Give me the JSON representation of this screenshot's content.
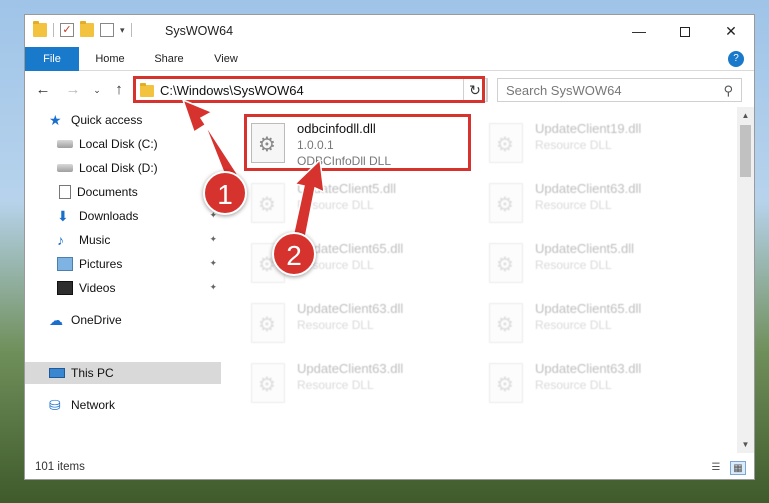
{
  "window": {
    "title": "SysWOW64",
    "minimize": "—",
    "maximize": "",
    "close": "✕"
  },
  "ribbon": {
    "tabs": [
      "File",
      "Home",
      "Share",
      "View"
    ],
    "expand": "?"
  },
  "nav": {
    "back": "←",
    "forward": "→",
    "recent": "⌄",
    "up": "↑",
    "address": "C:\\Windows\\SysWOW64",
    "address_drop": "⌄",
    "refresh": "↻",
    "search_placeholder": "Search SysWOW64",
    "search_icon": "search-icon"
  },
  "sidebar": {
    "items": [
      {
        "label": "Quick access",
        "icon": "star-icon",
        "pin": false
      },
      {
        "label": "Local Disk (C:)",
        "icon": "disk-icon",
        "pin": false
      },
      {
        "label": "Local Disk (D:)",
        "icon": "disk-icon",
        "pin": false
      },
      {
        "label": "Documents",
        "icon": "document-icon",
        "pin": true
      },
      {
        "label": "Downloads",
        "icon": "download-icon",
        "pin": true
      },
      {
        "label": "Music",
        "icon": "music-icon",
        "pin": true
      },
      {
        "label": "Pictures",
        "icon": "picture-icon",
        "pin": true
      },
      {
        "label": "Videos",
        "icon": "video-icon",
        "pin": true
      },
      {
        "label": "OneDrive",
        "icon": "cloud-icon",
        "pin": false
      },
      {
        "label": "This PC",
        "icon": "pc-icon",
        "pin": false,
        "selected": true
      },
      {
        "label": "Network",
        "icon": "network-icon",
        "pin": false
      }
    ],
    "pin_glyph": "📌"
  },
  "files": {
    "highlighted": {
      "name": "odbcinfodll.dll",
      "version": "1.0.0.1",
      "description": "ODBCInfoDll DLL"
    },
    "background": [
      {
        "name": "UpdateClient19.dll",
        "desc": "Resource DLL"
      },
      {
        "name": "UpdateClient5.dll",
        "desc": "Resource DLL"
      },
      {
        "name": "UpdateClient63.dll",
        "desc": "Resource DLL"
      },
      {
        "name": "UpdateClient65.dll",
        "desc": "Resource DLL"
      },
      {
        "name": "UpdateClient5.dll",
        "desc": "Resource DLL"
      },
      {
        "name": "UpdateClient63.dll",
        "desc": "Resource DLL"
      },
      {
        "name": "UpdateClient65.dll",
        "desc": "Resource DLL"
      },
      {
        "name": "UpdateClient63.dll",
        "desc": "Resource DLL"
      },
      {
        "name": "UpdateClient63.dll",
        "desc": "Resource DLL"
      }
    ]
  },
  "status": {
    "count": "101 items"
  },
  "annotations": {
    "step1": "1",
    "step2": "2",
    "color": "#d6322e"
  },
  "colors": {
    "accent": "#1979ca",
    "highlight": "#d6322e"
  }
}
